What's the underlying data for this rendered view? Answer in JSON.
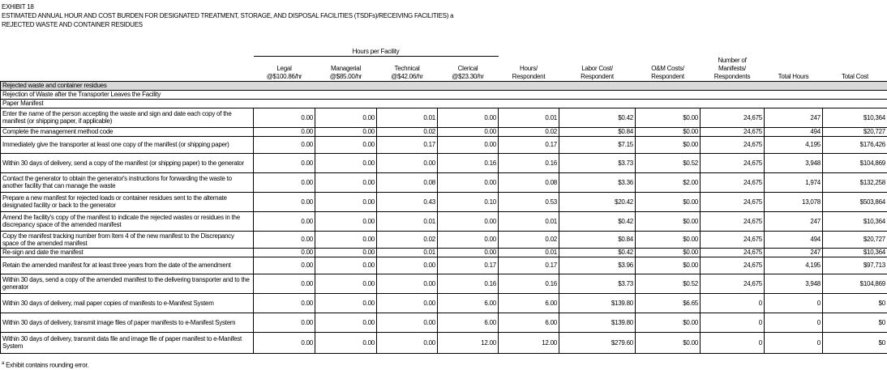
{
  "exhibit": {
    "number": "EXHIBIT 18",
    "title_line1": "ESTIMATED ANNUAL HOUR AND COST BURDEN FOR DESIGNATED TREATMENT, STORAGE, AND DISPOSAL FACILITIES (TSDFs)/RECEIVING FACILITIES) a",
    "title_line2": "REJECTED WASTE AND CONTAINER RESIDUES"
  },
  "headers": {
    "group": "Hours per Facility",
    "legal": [
      "Legal",
      "@$100.86/hr"
    ],
    "managerial": [
      "Managerial",
      "@$85.00/hr"
    ],
    "technical": [
      "Technical",
      "@$42.06/hr"
    ],
    "clerical": [
      "Clerical",
      "@$23.30/hr"
    ],
    "hours_resp": [
      "Hours/",
      "Respondent"
    ],
    "labor_cost": [
      "Labor Cost/",
      "Respondent"
    ],
    "om_cost": [
      "O&M Costs/",
      "Respondent"
    ],
    "num_manifests": [
      "Number of",
      "Manifests/",
      "Respondents"
    ],
    "total_hours": "Total Hours",
    "total_cost": "Total Cost"
  },
  "section": "Rejected waste and container residues",
  "subsection": "Rejection of Waste after the Transporter Leaves the Facility",
  "subsubsection": "Paper Manifest",
  "rows": [
    {
      "desc": "Enter the name of the person accepting the waste and sign and date each copy of the manifest (or shipping paper, if applicable)",
      "legal": "0.00",
      "managerial": "0.00",
      "technical": "0.01",
      "clerical": "0.00",
      "hours": "0.01",
      "labor": "$0.42",
      "om": "$0.00",
      "number": "24,675",
      "total_hours": "247",
      "total_cost": "$10,364"
    },
    {
      "desc": "Complete the management method code",
      "legal": "0.00",
      "managerial": "0.00",
      "technical": "0.02",
      "clerical": "0.00",
      "hours": "0.02",
      "labor": "$0.84",
      "om": "$0.00",
      "number": "24,675",
      "total_hours": "494",
      "total_cost": "$20,727"
    },
    {
      "desc": "Immediately give the transporter at least one copy of the manifest (or shipping paper)",
      "legal": "0.00",
      "managerial": "0.00",
      "technical": "0.17",
      "clerical": "0.00",
      "hours": "0.17",
      "labor": "$7.15",
      "om": "$0.00",
      "number": "24,675",
      "total_hours": "4,195",
      "total_cost": "$176,426"
    },
    {
      "desc": "Within 30 days of delivery, send a copy of the manifest (or shipping paper) to the generator",
      "legal": "0.00",
      "managerial": "0.00",
      "technical": "0.00",
      "clerical": "0.16",
      "hours": "0.16",
      "labor": "$3.73",
      "om": "$0.52",
      "number": "24,675",
      "total_hours": "3,948",
      "total_cost": "$104,869"
    },
    {
      "desc": "Contact the generator to obtain the generator's instructions for forwarding the waste to another facility that can manage the waste",
      "legal": "0.00",
      "managerial": "0.00",
      "technical": "0.08",
      "clerical": "0.00",
      "hours": "0.08",
      "labor": "$3.36",
      "om": "$2.00",
      "number": "24,675",
      "total_hours": "1,974",
      "total_cost": "$132,258"
    },
    {
      "desc": "Prepare a new manifest for rejected loads or container residues sent to the alternate designated facility or back to the generator",
      "legal": "0.00",
      "managerial": "0.00",
      "technical": "0.43",
      "clerical": "0.10",
      "hours": "0.53",
      "labor": "$20.42",
      "om": "$0.00",
      "number": "24,675",
      "total_hours": "13,078",
      "total_cost": "$503,864"
    },
    {
      "desc": "Amend the facility's copy of the manifest to indicate the rejected wastes or residues in the discrepancy space of the amended manifest",
      "legal": "0.00",
      "managerial": "0.00",
      "technical": "0.01",
      "clerical": "0.00",
      "hours": "0.01",
      "labor": "$0.42",
      "om": "$0.00",
      "number": "24,675",
      "total_hours": "247",
      "total_cost": "$10,364"
    },
    {
      "desc": "Copy the manifest tracking number from Item 4 of the new manifest to the Discrepancy space of the amended manifest",
      "legal": "0.00",
      "managerial": "0.00",
      "technical": "0.02",
      "clerical": "0.00",
      "hours": "0.02",
      "labor": "$0.84",
      "om": "$0.00",
      "number": "24,675",
      "total_hours": "494",
      "total_cost": "$20,727"
    },
    {
      "desc": "Re-sign and date the manifest",
      "legal": "0.00",
      "managerial": "0.00",
      "technical": "0.01",
      "clerical": "0.00",
      "hours": "0.01",
      "labor": "$0.42",
      "om": "$0.00",
      "number": "24,675",
      "total_hours": "247",
      "total_cost": "$10,364"
    },
    {
      "desc": "Retain the amended manifest for at least three years from the date of the amendment",
      "legal": "0.00",
      "managerial": "0.00",
      "technical": "0.00",
      "clerical": "0.17",
      "hours": "0.17",
      "labor": "$3.96",
      "om": "$0.00",
      "number": "24,675",
      "total_hours": "4,195",
      "total_cost": "$97,713"
    },
    {
      "desc": "Within 30 days, send a copy of the amended manifest to the delivering transporter and to the generator",
      "legal": "0.00",
      "managerial": "0.00",
      "technical": "0.00",
      "clerical": "0.16",
      "hours": "0.16",
      "labor": "$3.73",
      "om": "$0.52",
      "number": "24,675",
      "total_hours": "3,948",
      "total_cost": "$104,869"
    },
    {
      "desc": "Within 30 days of delivery, mail paper copies of manifests to e-Manifest System",
      "legal": "0.00",
      "managerial": "0.00",
      "technical": "0.00",
      "clerical": "6.00",
      "hours": "6.00",
      "labor": "$139.80",
      "om": "$6.65",
      "number": "0",
      "total_hours": "0",
      "total_cost": "$0"
    },
    {
      "desc": "Within 30 days of delivery, transmit image files of paper manifests to e-Manifest System",
      "legal": "0.00",
      "managerial": "0.00",
      "technical": "0.00",
      "clerical": "6.00",
      "hours": "6.00",
      "labor": "$139.80",
      "om": "$0.00",
      "number": "0",
      "total_hours": "0",
      "total_cost": "$0"
    },
    {
      "desc": "Within 30 days of delivery, transmit data file and image file of paper manifest to e-Manifest System",
      "legal": "0.00",
      "managerial": "0.00",
      "technical": "0.00",
      "clerical": "12.00",
      "hours": "12.00",
      "labor": "$279.60",
      "om": "$0.00",
      "number": "0",
      "total_hours": "0",
      "total_cost": "$0"
    }
  ],
  "footnote": {
    "marker": "a",
    "text": "Exhibit contains rounding error."
  }
}
